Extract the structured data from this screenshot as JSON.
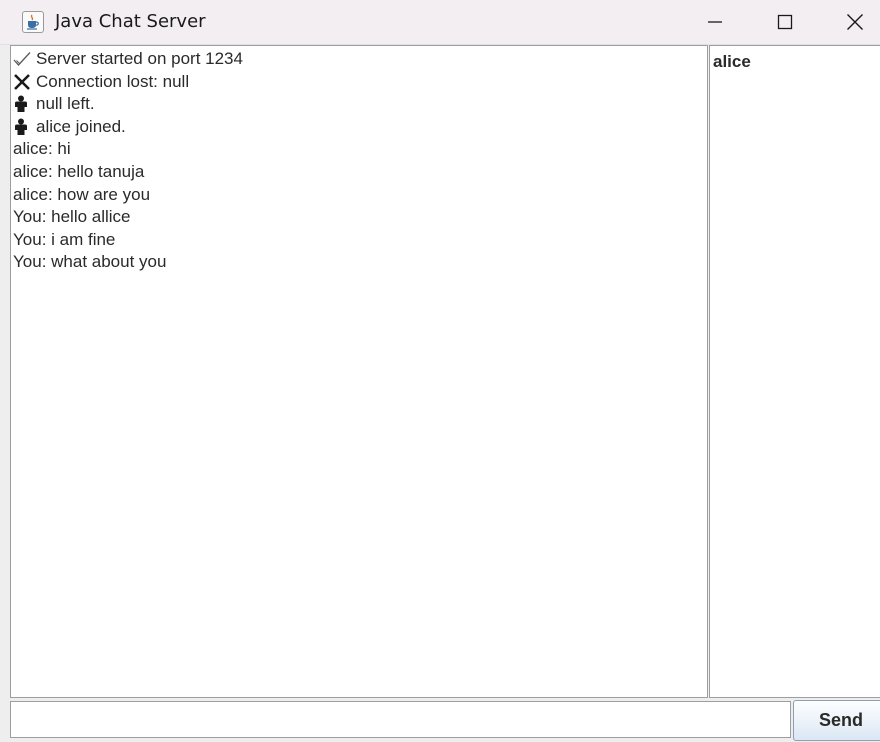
{
  "window": {
    "title": "Java Chat Server",
    "app_icon": "java-cup-icon",
    "controls": [
      "minimize-icon",
      "maximize-icon",
      "close-icon"
    ]
  },
  "chat": {
    "messages": [
      {
        "icon": "check-icon",
        "text": "Server started on port 1234"
      },
      {
        "icon": "x-icon",
        "text": "Connection lost: null"
      },
      {
        "icon": "person-icon",
        "text": "null left."
      },
      {
        "icon": "person-icon",
        "text": "alice joined."
      },
      {
        "icon": "",
        "text": "alice: hi"
      },
      {
        "icon": "",
        "text": "alice: hello tanuja"
      },
      {
        "icon": "",
        "text": "alice: how are you"
      },
      {
        "icon": "",
        "text": "You: hello allice"
      },
      {
        "icon": "",
        "text": "You: i am fine"
      },
      {
        "icon": "",
        "text": "You: what about you"
      }
    ]
  },
  "users": {
    "items": [
      "alice"
    ]
  },
  "composer": {
    "input_value": "",
    "send_label": "Send"
  }
}
